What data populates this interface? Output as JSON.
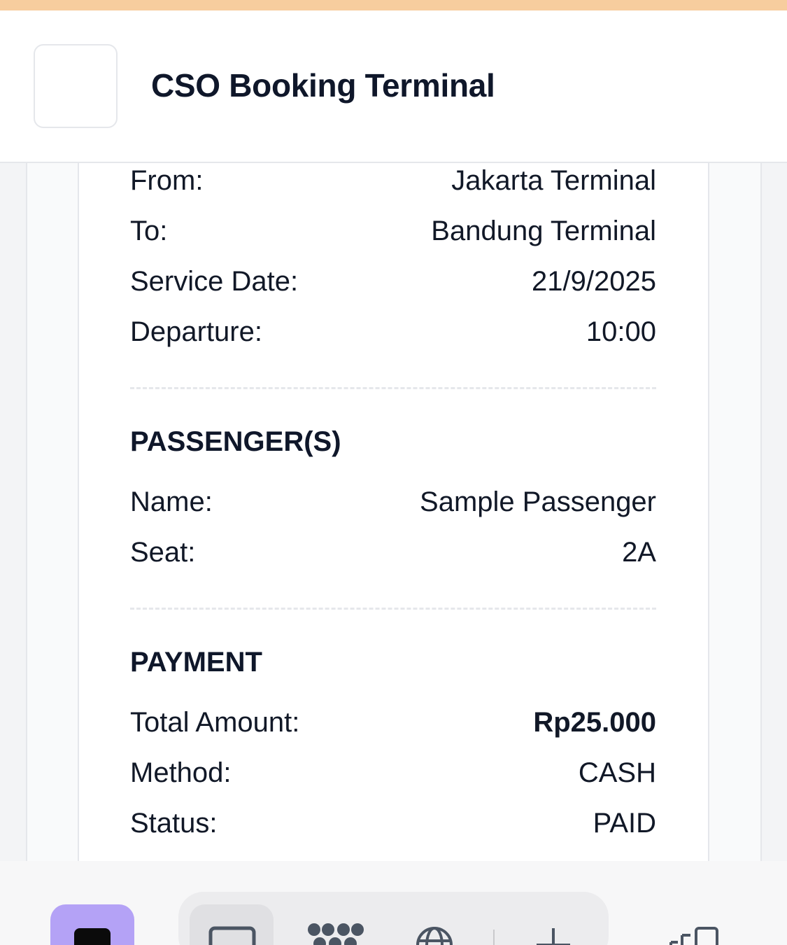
{
  "header": {
    "title": "CSO Booking Terminal"
  },
  "trip": {
    "from_label": "From:",
    "from_value": "Jakarta Terminal",
    "to_label": "To:",
    "to_value": "Bandung Terminal",
    "date_label": "Service Date:",
    "date_value": "21/9/2025",
    "departure_label": "Departure:",
    "departure_value": "10:00"
  },
  "passengers": {
    "title": "PASSENGER(S)",
    "name_label": "Name:",
    "name_value": "Sample Passenger",
    "seat_label": "Seat:",
    "seat_value": "2A"
  },
  "payment": {
    "title": "PAYMENT",
    "total_label": "Total Amount:",
    "total_value": "Rp25.000",
    "method_label": "Method:",
    "method_value": "CASH",
    "status_label": "Status:",
    "status_value": "PAID"
  },
  "nav": {
    "icons": [
      "home-icon",
      "window-icon",
      "apps-grid-icon",
      "globe-icon",
      "add-icon",
      "recents-icon"
    ]
  },
  "colors": {
    "top_stripe": "#f7cd9e",
    "home_button": "#b4a2f6",
    "text": "#111827"
  }
}
